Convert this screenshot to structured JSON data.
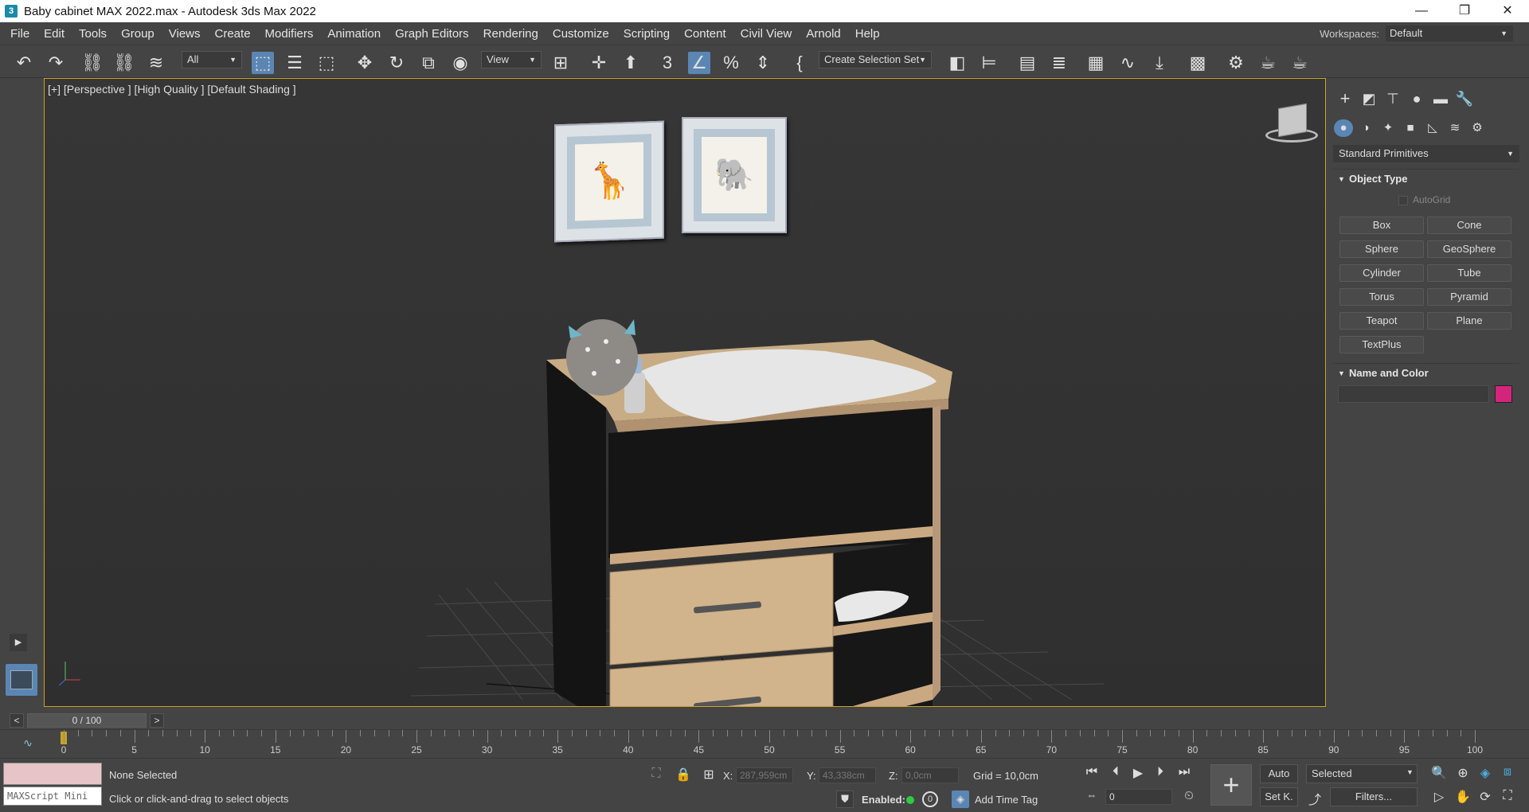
{
  "window": {
    "title": "Baby cabinet MAX 2022.max - Autodesk 3ds Max 2022",
    "app_icon": "3",
    "controls": [
      "—",
      "❐",
      "✕"
    ]
  },
  "menu": [
    "File",
    "Edit",
    "Tools",
    "Group",
    "Views",
    "Create",
    "Modifiers",
    "Animation",
    "Graph Editors",
    "Rendering",
    "Customize",
    "Scripting",
    "Content",
    "Civil View",
    "Arnold",
    "Help"
  ],
  "workspace": {
    "label": "Workspaces:",
    "value": "Default"
  },
  "toolbar": {
    "filter": "All",
    "coord_system": "View",
    "selection_set": "Create Selection Set"
  },
  "viewport": {
    "label": "[+] [Perspective ] [High Quality ] [Default Shading ]"
  },
  "command_panel": {
    "category": "Standard Primitives",
    "object_type_title": "Object Type",
    "autogrid": "AutoGrid",
    "primitives": [
      "Box",
      "Cone",
      "Sphere",
      "GeoSphere",
      "Cylinder",
      "Tube",
      "Torus",
      "Pyramid",
      "Teapot",
      "Plane",
      "TextPlus"
    ],
    "name_color_title": "Name and Color",
    "object_color": "#d4257c"
  },
  "timeline": {
    "frame_counter": "0 / 100",
    "prev": "<",
    "next": ">",
    "ticks": [
      "0",
      "5",
      "10",
      "15",
      "20",
      "25",
      "30",
      "35",
      "40",
      "45",
      "50",
      "55",
      "60",
      "65",
      "70",
      "75",
      "80",
      "85",
      "90",
      "95",
      "100"
    ]
  },
  "status": {
    "maxscript": "MAXScript Mini",
    "selection": "None Selected",
    "prompt": "Click or click-and-drag to select objects",
    "x_label": "X:",
    "x_value": "287,959cm",
    "y_label": "Y:",
    "y_value": "43,338cm",
    "z_label": "Z:",
    "z_value": "0,0cm",
    "grid": "Grid = 10,0cm",
    "enabled_label": "Enabled:",
    "enabled_value": "0",
    "add_time_tag": "Add Time Tag",
    "auto": "Auto",
    "selected": "Selected",
    "set_key": "Set K.",
    "filters": "Filters...",
    "frame": "0"
  }
}
